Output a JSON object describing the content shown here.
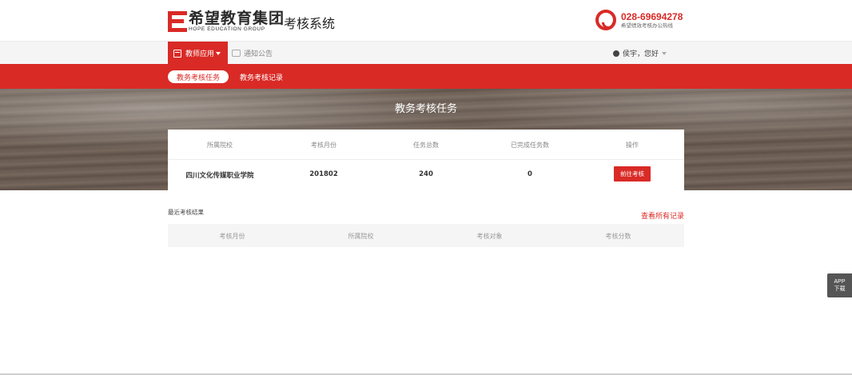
{
  "header": {
    "logo_cn": "希望教育集团",
    "logo_en": "HOPE EDUCATION GROUP",
    "system_title": "考核系统",
    "hotline_number": "028-69694278",
    "hotline_desc": "希望绩效考核办公热线",
    "brand_color": "#d92a26"
  },
  "nav": {
    "teacher_app": "教师应用",
    "notice": "通知公告",
    "user_greeting": "侯宇，您好"
  },
  "subnav": {
    "tabs": [
      {
        "label": "教务考核任务",
        "active": true
      },
      {
        "label": "教务考核记录",
        "active": false
      }
    ]
  },
  "banner": {
    "title": "教务考核任务"
  },
  "task_table": {
    "headers": [
      "所属院校",
      "考核月份",
      "任务总数",
      "已完成任务数",
      "操作"
    ],
    "rows": [
      {
        "school": "四川文化传媒职业学院",
        "month": "201802",
        "total": "240",
        "done": "0",
        "action": "前往考核"
      }
    ]
  },
  "recent": {
    "label": "最近考核结果",
    "view_all": "查看所有记录",
    "headers": [
      "考核月份",
      "所属院校",
      "考核对象",
      "考核分数"
    ]
  },
  "side": {
    "app_line1": "APP",
    "app_line2": "下载"
  }
}
